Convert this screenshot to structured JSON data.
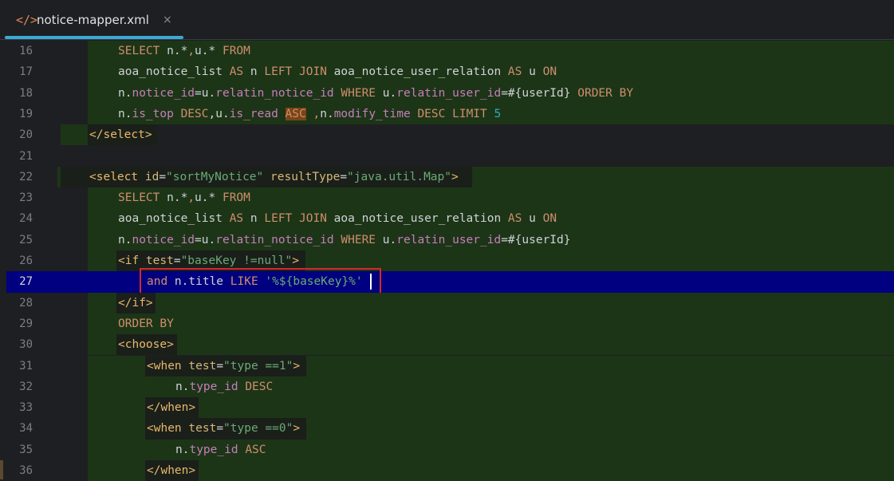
{
  "tab": {
    "icon": "</>",
    "filename": "notice-mapper.xml",
    "close": "×"
  },
  "colors": {
    "sql_block_bg": "#1c3517",
    "tag_bg": "#1a1f1a",
    "current_line_bg": "#000080",
    "highlight_box": "#d62828",
    "asc_highlight_bg": "#7a4416",
    "tab_underline": "#3ba9d7"
  },
  "editor": {
    "current_line": 27,
    "lines": [
      {
        "n": "16",
        "indent": 2,
        "tokens": [
          [
            "SELECT ",
            "kw"
          ],
          [
            "n.*",
            "df"
          ],
          [
            ",",
            "kw"
          ],
          [
            "u.* ",
            "df"
          ],
          [
            "FROM",
            "kw"
          ]
        ]
      },
      {
        "n": "17",
        "indent": 2,
        "tokens": [
          [
            "aoa_notice_list ",
            "df"
          ],
          [
            "AS ",
            "kw"
          ],
          [
            "n ",
            "df"
          ],
          [
            "LEFT JOIN ",
            "kw"
          ],
          [
            "aoa_notice_user_relation ",
            "df"
          ],
          [
            "AS ",
            "kw"
          ],
          [
            "u ",
            "df"
          ],
          [
            "ON",
            "kw"
          ]
        ]
      },
      {
        "n": "18",
        "indent": 2,
        "tokens": [
          [
            "n.",
            "df"
          ],
          [
            "notice_id",
            "fld"
          ],
          [
            "=u.",
            "df"
          ],
          [
            "relatin_notice_id ",
            "fld"
          ],
          [
            "WHERE ",
            "kw"
          ],
          [
            "u.",
            "df"
          ],
          [
            "relatin_user_id",
            "fld"
          ],
          [
            "=#{userId} ",
            "df"
          ],
          [
            "ORDER BY",
            "kw"
          ]
        ]
      },
      {
        "n": "19",
        "indent": 2,
        "tokens": [
          [
            "n.",
            "df"
          ],
          [
            "is_top ",
            "fld"
          ],
          [
            "DESC",
            "kw"
          ],
          [
            ",u.",
            "df"
          ],
          [
            "is_read ",
            "fld"
          ],
          [
            "ASC",
            "kwhl"
          ],
          [
            " ,",
            "kw"
          ],
          [
            "n.",
            "df"
          ],
          [
            "modify_time ",
            "fld"
          ],
          [
            "DESC ",
            "kw"
          ],
          [
            "LIMIT ",
            "kw"
          ],
          [
            "5",
            "num"
          ]
        ]
      },
      {
        "n": "20",
        "indent": 1,
        "tokens": [
          [
            "</select>",
            "tag"
          ]
        ]
      },
      {
        "n": "21",
        "indent": 0,
        "tokens": []
      },
      {
        "n": "22",
        "indent": 1,
        "tokens": [
          [
            "<select ",
            "tag"
          ],
          [
            "id",
            "att"
          ],
          [
            "=",
            "df"
          ],
          [
            "\"sortMyNotice\" ",
            "str"
          ],
          [
            "resultType",
            "att"
          ],
          [
            "=",
            "df"
          ],
          [
            "\"java.util.Map\"",
            "str"
          ],
          [
            ">",
            "tag"
          ]
        ]
      },
      {
        "n": "23",
        "indent": 2,
        "tokens": [
          [
            "SELECT ",
            "kw"
          ],
          [
            "n.*",
            "df"
          ],
          [
            ",",
            "kw"
          ],
          [
            "u.* ",
            "df"
          ],
          [
            "FROM",
            "kw"
          ]
        ]
      },
      {
        "n": "24",
        "indent": 2,
        "tokens": [
          [
            "aoa_notice_list ",
            "df"
          ],
          [
            "AS ",
            "kw"
          ],
          [
            "n ",
            "df"
          ],
          [
            "LEFT JOIN ",
            "kw"
          ],
          [
            "aoa_notice_user_relation ",
            "df"
          ],
          [
            "AS ",
            "kw"
          ],
          [
            "u ",
            "df"
          ],
          [
            "ON",
            "kw"
          ]
        ]
      },
      {
        "n": "25",
        "indent": 2,
        "tokens": [
          [
            "n.",
            "df"
          ],
          [
            "notice_id",
            "fld"
          ],
          [
            "=u.",
            "df"
          ],
          [
            "relatin_notice_id ",
            "fld"
          ],
          [
            "WHERE ",
            "kw"
          ],
          [
            "u.",
            "df"
          ],
          [
            "relatin_user_id",
            "fld"
          ],
          [
            "=#{userId}",
            "df"
          ]
        ]
      },
      {
        "n": "26",
        "indent": 2,
        "tokens": [
          [
            "<if ",
            "tag"
          ],
          [
            "test",
            "att"
          ],
          [
            "=",
            "df"
          ],
          [
            "\"baseKey !=null\"",
            "str"
          ],
          [
            ">",
            "tag"
          ]
        ]
      },
      {
        "n": "27",
        "indent": 3,
        "tokens": [
          [
            "and ",
            "kw"
          ],
          [
            "n.title ",
            "df"
          ],
          [
            "LIKE ",
            "kw"
          ],
          [
            "'%${baseKey}%'",
            "str"
          ]
        ]
      },
      {
        "n": "28",
        "indent": 2,
        "tokens": [
          [
            "</if>",
            "tag"
          ]
        ]
      },
      {
        "n": "29",
        "indent": 2,
        "tokens": [
          [
            "ORDER BY",
            "kw"
          ]
        ]
      },
      {
        "n": "30",
        "indent": 2,
        "tokens": [
          [
            "<choose>",
            "tag"
          ]
        ]
      },
      {
        "n": "31",
        "indent": 3,
        "tokens": [
          [
            "<when ",
            "tag"
          ],
          [
            "test",
            "att"
          ],
          [
            "=",
            "df"
          ],
          [
            "\"type ==1\"",
            "str"
          ],
          [
            ">",
            "tag"
          ]
        ]
      },
      {
        "n": "32",
        "indent": 4,
        "tokens": [
          [
            "n.",
            "df"
          ],
          [
            "type_id ",
            "fld"
          ],
          [
            "DESC",
            "kw"
          ]
        ]
      },
      {
        "n": "33",
        "indent": 3,
        "tokens": [
          [
            "</when>",
            "tag"
          ]
        ]
      },
      {
        "n": "34",
        "indent": 3,
        "tokens": [
          [
            "<when ",
            "tag"
          ],
          [
            "test",
            "att"
          ],
          [
            "=",
            "df"
          ],
          [
            "\"type ==0\"",
            "str"
          ],
          [
            ">",
            "tag"
          ]
        ]
      },
      {
        "n": "35",
        "indent": 4,
        "tokens": [
          [
            "n.",
            "df"
          ],
          [
            "type_id ",
            "fld"
          ],
          [
            "ASC",
            "kw"
          ]
        ]
      },
      {
        "n": "36",
        "indent": 3,
        "tokens": [
          [
            "</when>",
            "tag"
          ]
        ]
      }
    ]
  }
}
